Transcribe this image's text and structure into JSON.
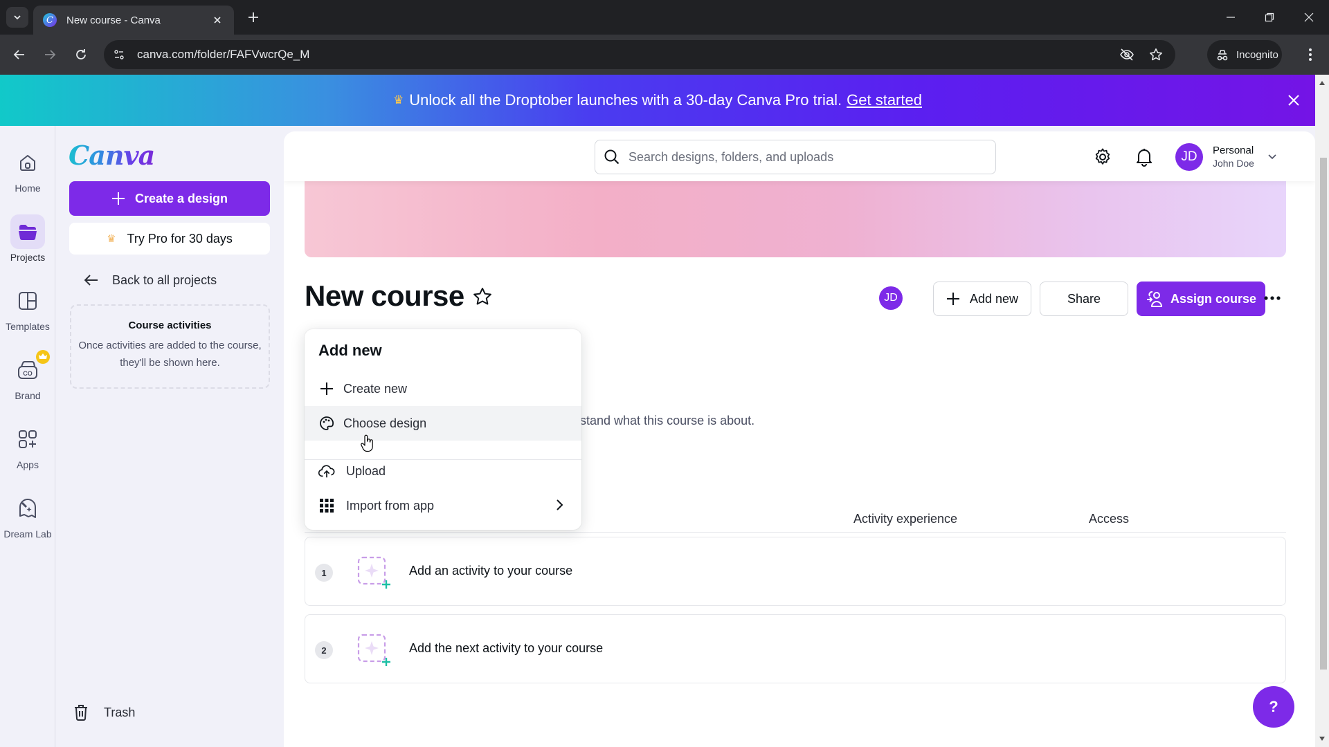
{
  "browser": {
    "tab_title": "New course - Canva",
    "url": "canva.com/folder/FAFVwcrQe_M",
    "incognito_label": "Incognito"
  },
  "promo": {
    "message": "Unlock all the Droptober launches with a 30-day Canva Pro trial.",
    "link_label": "Get started"
  },
  "rail": {
    "items": [
      {
        "label": "Home",
        "icon": "home-icon"
      },
      {
        "label": "Projects",
        "icon": "folder-icon",
        "active": true
      },
      {
        "label": "Templates",
        "icon": "templates-icon"
      },
      {
        "label": "Brand",
        "icon": "brand-icon",
        "badge": "crown"
      },
      {
        "label": "Apps",
        "icon": "apps-icon"
      },
      {
        "label": "Dream Lab",
        "icon": "dream-lab-icon"
      }
    ]
  },
  "sidebar": {
    "logo": "Canva",
    "create_label": "Create a design",
    "try_pro_label": "Try Pro for 30 days",
    "back_label": "Back to all projects",
    "activities_title": "Course activities",
    "activities_body": "Once activities are added to the course, they'll be shown here.",
    "trash_label": "Trash"
  },
  "topbar": {
    "search_placeholder": "Search designs, folders, and uploads",
    "account_type": "Personal",
    "account_name": "John Doe",
    "avatar_initials": "JD"
  },
  "course": {
    "title": "New course",
    "collaborator_initials": "JD",
    "add_new_label": "Add new",
    "share_label": "Share",
    "assign_label": "Assign course",
    "description_partial": "stand what this course is about.",
    "columns": [
      "Activity experience",
      "Access"
    ],
    "activities": [
      {
        "number": "1",
        "label": "Add an activity to your course"
      },
      {
        "number": "2",
        "label": "Add the next activity to your course"
      }
    ]
  },
  "add_menu": {
    "title": "Add new",
    "items": [
      {
        "label": "Create new",
        "icon": "plus-icon"
      },
      {
        "label": "Choose design",
        "icon": "palette-icon",
        "hovered": true
      },
      {
        "label": "Upload",
        "icon": "cloud-upload-icon"
      },
      {
        "label": "Import from app",
        "icon": "grid-icon",
        "has_submenu": true
      }
    ]
  },
  "help": {
    "label": "?"
  },
  "colors": {
    "brand_purple": "#7d2ae8",
    "page_bg": "#f1f1f9",
    "promo_gradient_start": "#11c9c9",
    "promo_gradient_end": "#7414e6"
  }
}
